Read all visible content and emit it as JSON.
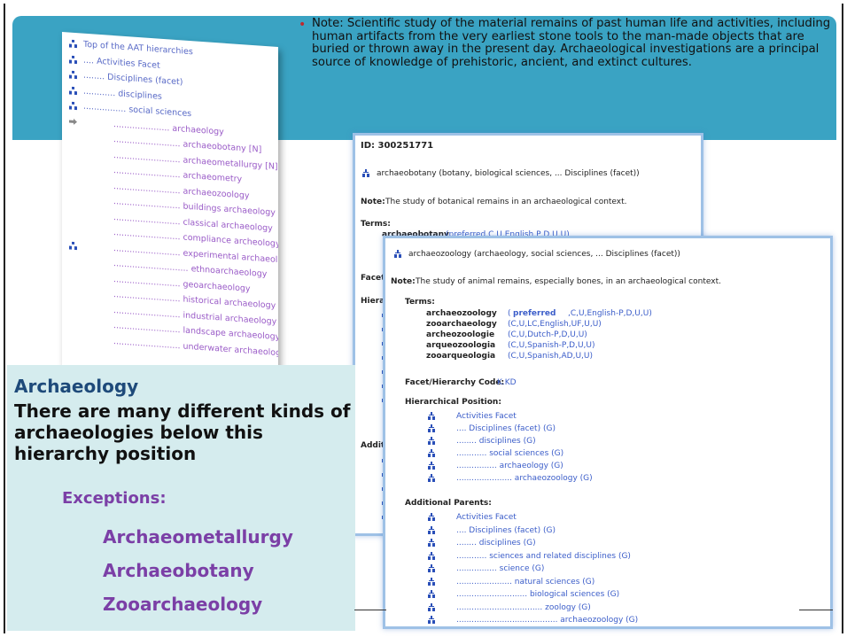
{
  "note": {
    "bullet": "•",
    "text": "Note: Scientific study of the material remains of past human life and activities, including human artifacts from the very earliest stone tools to the man-made objects that are buried or thrown away in the present day. Archaeological investigations are a principal source of knowledge of prehistoric, ancient, and extinct cultures."
  },
  "tree": {
    "rows": [
      {
        "label": "Top of the AAT hierarchies",
        "indent": 0,
        "icon": "hierarchy-icon"
      },
      {
        "label": ".... Activities Facet",
        "indent": 10,
        "icon": "hierarchy-icon"
      },
      {
        "label": "........ Disciplines (facet)",
        "indent": 18,
        "icon": "hierarchy-icon"
      },
      {
        "label": "............ disciplines",
        "indent": 24,
        "icon": "hierarchy-icon"
      },
      {
        "label": "................ social sciences",
        "indent": 30,
        "icon": "hierarchy-icon"
      },
      {
        "label": "..................... archaeology",
        "indent": 36,
        "icon": "arrow-icon"
      },
      {
        "label": "......................... archaeobotany [N]",
        "indent": 0,
        "icon": ""
      },
      {
        "label": "......................... archaeometallurgy [N]",
        "indent": 0,
        "icon": ""
      },
      {
        "label": "......................... archaeometry",
        "indent": 0,
        "icon": ""
      },
      {
        "label": "......................... archaeozoology",
        "indent": 0,
        "icon": ""
      },
      {
        "label": "......................... buildings archaeology",
        "indent": 0,
        "icon": ""
      },
      {
        "label": "......................... classical archaeology",
        "indent": 0,
        "icon": ""
      },
      {
        "label": "......................... compliance archeology",
        "indent": 0,
        "icon": ""
      },
      {
        "label": "......................... experimental archaeology",
        "indent": 0,
        "icon": "hierarchy-icon"
      },
      {
        "label": "............................ ethnoarchaeology",
        "indent": 0,
        "icon": ""
      },
      {
        "label": "......................... geoarchaeology",
        "indent": 0,
        "icon": ""
      },
      {
        "label": "......................... historical archaeology",
        "indent": 0,
        "icon": ""
      },
      {
        "label": "......................... industrial archaeology",
        "indent": 0,
        "icon": ""
      },
      {
        "label": "......................... landscape archaeology",
        "indent": 0,
        "icon": ""
      },
      {
        "label": "......................... underwater archaeology",
        "indent": 0,
        "icon": ""
      }
    ]
  },
  "record1": {
    "id": "ID: 300251771",
    "heading": "archaeobotany (botany, biological sciences, ... Disciplines (facet))",
    "note_label": "Note:",
    "note_text": "The study of botanical remains in an archaeological context.",
    "terms_label": "Terms:",
    "term1_name": "archaeobotany",
    "term1_pref": "(preferred,C,U,English,P,D,U,U)",
    "facet_label": "Facet/",
    "hier_label": "Hierarc",
    "addl_label": "Additio"
  },
  "record2": {
    "heading": "archaeozoology (archaeology, social sciences, ... Disciplines (facet))",
    "note_label": "Note:",
    "note_text": "The study of animal remains, especially bones, in an archaeological context.",
    "terms_label": "Terms:",
    "terms": [
      {
        "name": "archaeozoology",
        "pref": "preferred",
        "meta": ",C,U,English-P,D,U,U)"
      },
      {
        "name": "zooarchaeology",
        "pref": "",
        "meta": "(C,U,LC,English,UF,U,U)"
      },
      {
        "name": "archeozoologie",
        "pref": "",
        "meta": "(C,U,Dutch-P,D,U,U)"
      },
      {
        "name": "arqueozoologia",
        "pref": "",
        "meta": "(C,U,Spanish-P,D,U,U)"
      },
      {
        "name": "zooarqueologia",
        "pref": "",
        "meta": "(C,U,Spanish,AD,U,U)"
      }
    ],
    "facet_label": "Facet/Hierarchy Code:",
    "facet_value": "K.KD",
    "hier_label": "Hierarchical Position:",
    "hier_rows": [
      "Activities Facet",
      ".... Disciplines (facet) (G)",
      "........ disciplines (G)",
      "............ social sciences (G)",
      "................ archaeology (G)",
      "...................... archaeozoology (G)"
    ],
    "addl_label": "Additional Parents:",
    "addl_rows": [
      "Activities Facet",
      ".... Disciplines (facet) (G)",
      "........ disciplines (G)",
      "............ sciences and related disciplines (G)",
      "................ science (G)",
      "...................... natural sciences (G)",
      "............................ biological sciences (G)",
      ".................................. zoology (G)",
      "........................................ archaeozoology (G)"
    ]
  },
  "textbox": {
    "title": "Archaeology",
    "body": "There are many different kinds of archaeologies below this hierarchy position",
    "exceptions_label": "Exceptions:",
    "items": [
      "Archaeometallurgy",
      "Archaeobotany",
      "Zooarchaeology"
    ]
  },
  "colors": {
    "banner": "#3aa3c3",
    "textbox": "#d5ecee",
    "exception": "#7b3fa6",
    "link": "#3b5dc9"
  }
}
